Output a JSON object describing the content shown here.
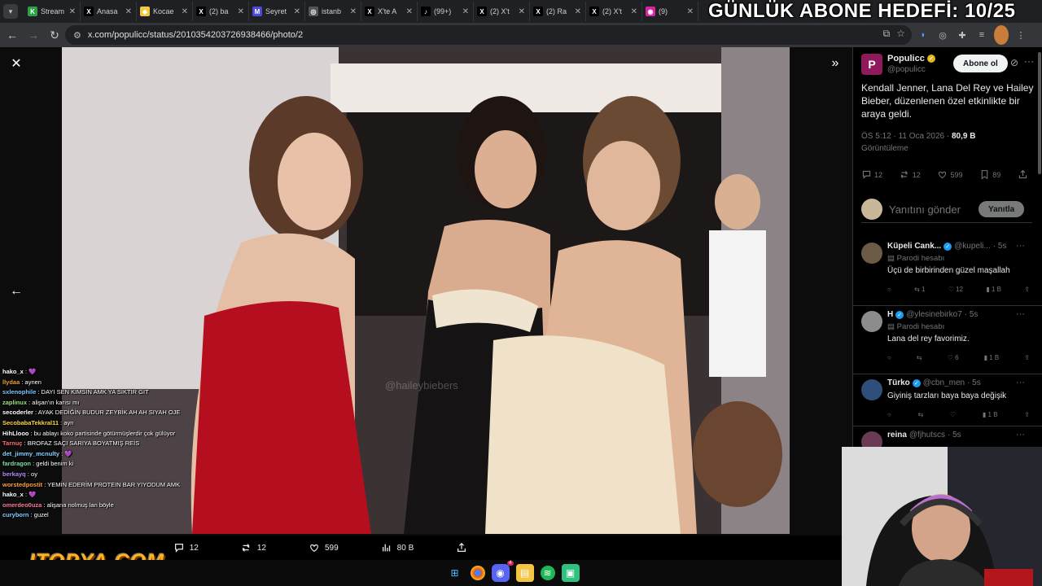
{
  "browser": {
    "tabs": [
      {
        "label": "Stream",
        "fav_bg": "#2ea043",
        "fav": "K"
      },
      {
        "label": "Anasa",
        "fav_bg": "#000000",
        "fav": "X"
      },
      {
        "label": "Kocae",
        "fav_bg": "#f2c744",
        "fav": "◆"
      },
      {
        "label": "(2) ba",
        "fav_bg": "#000000",
        "fav": "X"
      },
      {
        "label": "Seyret",
        "fav_bg": "#4b4bd8",
        "fav": "M"
      },
      {
        "label": "istanb",
        "fav_bg": "#555555",
        "fav": "◎"
      },
      {
        "label": "X'te A",
        "fav_bg": "#000000",
        "fav": "X"
      },
      {
        "label": "(99+)",
        "fav_bg": "#000000",
        "fav": "♪"
      },
      {
        "label": "(2) X't",
        "fav_bg": "#000000",
        "fav": "X"
      },
      {
        "label": "(2) Ra",
        "fav_bg": "#000000",
        "fav": "X"
      },
      {
        "label": "(2) X't",
        "fav_bg": "#000000",
        "fav": "X"
      },
      {
        "label": "(9)",
        "fav_bg": "#d6249f",
        "fav": "◉"
      }
    ],
    "url": "x.com/populicc/status/2010354203726938466/photo/2"
  },
  "overlay": {
    "goal": "GÜNLÜK ABONE HEDEFİ: 10/25",
    "logo": "ITOPYA.COM",
    "chat": [
      {
        "user": "hako_x",
        "msg": "💜",
        "color": "#ffffff"
      },
      {
        "user": "llydaa",
        "msg": "aynen",
        "color": "#e8a23a"
      },
      {
        "user": "sxlenophile",
        "msg": "DAYI SEN KİMSİN AMK YA SİKTİR GİT",
        "color": "#7ec8ff"
      },
      {
        "user": "zaplinux",
        "msg": "alişan'ın karısı mı",
        "color": "#9ee37d"
      },
      {
        "user": "secoderler",
        "msg": "AYAK DEDİĞİN BUDUR ZEYBİK AH AH SIYAH OJE",
        "color": "#ffffff"
      },
      {
        "user": "SecobabaTekkral11",
        "msg": "ayn",
        "color": "#ffd54a"
      },
      {
        "user": "HihLlooo",
        "msg": "bu ablayı koko partisinde götürmüşlerdir çok gülüyor",
        "color": "#ffffff"
      },
      {
        "user": "Tarnuç",
        "msg": "BROFAZ SAÇI SARIYA BOYATMIŞ REİS",
        "color": "#ff6f6f"
      },
      {
        "user": "det_jimmy_mcnulty",
        "msg": "💜",
        "color": "#8ad0ff"
      },
      {
        "user": "fardragon",
        "msg": "geldi benim ki",
        "color": "#7ee0a0"
      },
      {
        "user": "berkayq",
        "msg": "oy",
        "color": "#b08cff"
      },
      {
        "user": "worstedpostit",
        "msg": "YEMİN EDERİM PROTEIN BAR YIYODUM AMK",
        "color": "#ff9f43"
      },
      {
        "user": "hako_x",
        "msg": "💜",
        "color": "#ffffff"
      },
      {
        "user": "omerdeo0uza",
        "msg": "alişana nolmuş lan böyle",
        "color": "#ff7a9c"
      },
      {
        "user": "curyborn",
        "msg": "guzel",
        "color": "#7fd3ff"
      }
    ]
  },
  "media": {
    "watermark": "@haileybiebers",
    "actions": {
      "replies": "12",
      "reposts": "12",
      "likes": "599",
      "views": "80 B"
    }
  },
  "tweet": {
    "name": "Populicc",
    "handle": "@populicc",
    "follow_label": "Abone ol",
    "text": "Kendall Jenner, Lana Del Rey ve Hailey Bieber, düzenlenen özel etkinlikte bir araya geldi.",
    "time": "ÖS 5:12 · 11 Oca 2026 · ",
    "views_count": "80,9 B",
    "views_label": "Görüntüleme",
    "stats": {
      "replies": "12",
      "reposts": "12",
      "likes": "599",
      "bookmarks": "89"
    },
    "reply_placeholder": "Yanıtını gönder",
    "reply_button": "Yanıtla"
  },
  "replies": [
    {
      "name": "Küpeli Cank...",
      "handle": "@kupeli...",
      "time": "· 5s",
      "parody": "Parodi hesabı",
      "text": "Üçü de birbirinden güzel maşallah",
      "replies": "",
      "reposts": "1",
      "likes": "12",
      "views": "1 B",
      "badge": "#1d9bf0",
      "avatar": "#6b5a46"
    },
    {
      "name": "H",
      "handle": "@ylesinebirko7",
      "time": "· 5s",
      "parody": "Parodi hesabı",
      "text": "Lana del rey favorimiz.",
      "replies": "",
      "reposts": "",
      "likes": "6",
      "views": "1 B",
      "badge": "#1d9bf0",
      "avatar": "#8c8c8c"
    },
    {
      "name": "Türko",
      "handle": "@cbn_men",
      "time": "· 5s",
      "parody": "",
      "text": "Giyiniş tarzları baya baya değişik",
      "replies": "",
      "reposts": "",
      "likes": "",
      "views": "1 B",
      "badge": "#1d9bf0",
      "avatar": "#2e4f7a"
    },
    {
      "name": "reina",
      "handle": "@fjhutscs",
      "time": "· 5s",
      "parody": "",
      "text": "",
      "replies": "",
      "reposts": "",
      "likes": "",
      "views": "",
      "badge": "",
      "avatar": "#6a3b54"
    }
  ]
}
